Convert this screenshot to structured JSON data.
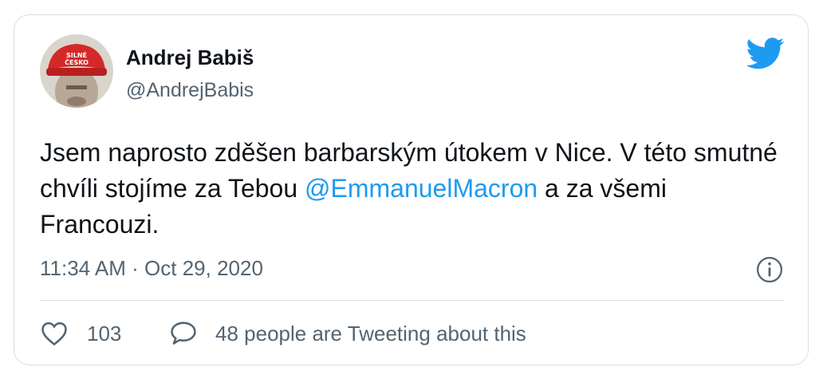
{
  "author": {
    "name": "Andrej Babiš",
    "handle": "@AndrejBabis",
    "avatar_cap_text_line1": "SILNÉ",
    "avatar_cap_text_line2": "ČESKO"
  },
  "tweet": {
    "text_part1": "Jsem naprosto zděšen barbarským útokem v Nice. V této smutné chvíli stojíme za Tebou ",
    "mention": "@EmmanuelMacron",
    "text_part2": " a za všemi Francouzi."
  },
  "meta": {
    "time": "11:34 AM · Oct 29, 2020"
  },
  "actions": {
    "likes": "103",
    "tweeting": "48 people are Tweeting about this"
  },
  "icons": {
    "brand": "twitter-bird-icon",
    "info": "info-icon",
    "like": "heart-icon",
    "reply": "speech-bubble-icon"
  },
  "colors": {
    "brand_blue": "#1d9bf0",
    "text": "#0f1419",
    "muted": "#536471"
  }
}
